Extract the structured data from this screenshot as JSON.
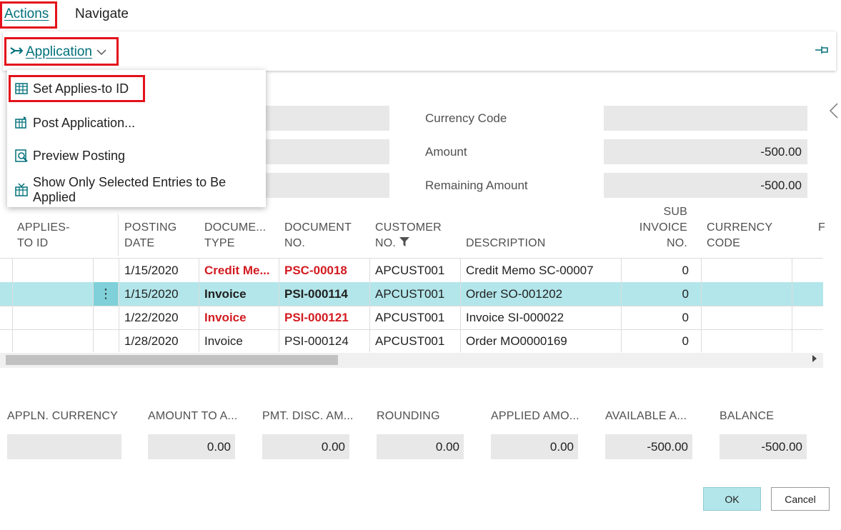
{
  "tabs": {
    "actions": "Actions",
    "navigate": "Navigate"
  },
  "action_bar": {
    "application_label": "Application",
    "app_icon": "application-arrow-icon",
    "pin_icon": "pin-icon"
  },
  "menu": {
    "items": [
      {
        "label": "Set Applies-to ID",
        "icon": "set-applies-to-icon"
      },
      {
        "label": "Post Application...",
        "icon": "post-application-icon"
      },
      {
        "label": "Preview Posting",
        "icon": "preview-posting-icon"
      },
      {
        "label": "Show Only Selected Entries to Be Applied",
        "icon": "show-selected-icon"
      }
    ]
  },
  "header_fields": {
    "currency_code": {
      "label": "Currency Code",
      "value": ""
    },
    "amount": {
      "label": "Amount",
      "value": "-500.00"
    },
    "remaining_amount": {
      "label": "Remaining Amount",
      "value": "-500.00"
    }
  },
  "table": {
    "columns": {
      "applies_to_id": [
        "APPLIES-",
        "TO ID"
      ],
      "posting_date": [
        "POSTING",
        "DATE"
      ],
      "document_type": [
        "DOCUME...",
        "TYPE"
      ],
      "document_no": [
        "DOCUMENT",
        "NO."
      ],
      "customer_no": [
        "CUSTOMER",
        "NO."
      ],
      "description": [
        "DESCRIPTION"
      ],
      "sub_invoice_no": [
        "SUB",
        "INVOICE",
        "NO."
      ],
      "currency_code": [
        "CURRENCY",
        "CODE"
      ],
      "truncated": "F"
    },
    "rows": [
      {
        "posting_date": "1/15/2020",
        "document_type": "Credit Me...",
        "document_no": "PSC-00018",
        "customer_no": "APCUST001",
        "description": "Credit Memo SC-00007",
        "sub_invoice_no": "0"
      },
      {
        "posting_date": "1/15/2020",
        "document_type": "Invoice",
        "document_no": "PSI-000114",
        "customer_no": "APCUST001",
        "description": "Order SO-001202",
        "sub_invoice_no": "0"
      },
      {
        "posting_date": "1/22/2020",
        "document_type": "Invoice",
        "document_no": "PSI-000121",
        "customer_no": "APCUST001",
        "description": "Invoice SI-000022",
        "sub_invoice_no": "0"
      },
      {
        "posting_date": "1/28/2020",
        "document_type": "Invoice",
        "document_no": "PSI-000124",
        "customer_no": "APCUST001",
        "description": "Order MO0000169",
        "sub_invoice_no": "0"
      }
    ],
    "row_menu": "⋮"
  },
  "footer": {
    "appln_currency": {
      "label": "APPLN. CURRENCY",
      "value": ""
    },
    "amount_to_apply": {
      "label": "AMOUNT TO A...",
      "value": "0.00"
    },
    "pmt_disc_amount": {
      "label": "PMT. DISC. AM...",
      "value": "0.00"
    },
    "rounding": {
      "label": "ROUNDING",
      "value": "0.00"
    },
    "applied_amount": {
      "label": "APPLIED AMO...",
      "value": "0.00"
    },
    "available_amount": {
      "label": "AVAILABLE A...",
      "value": "-500.00"
    },
    "balance": {
      "label": "BALANCE",
      "value": "-500.00"
    }
  },
  "buttons": {
    "ok": "OK",
    "cancel": "Cancel"
  },
  "colors": {
    "accent": "#00707a",
    "highlight": "#e3121b",
    "selected_row": "#b3e6ea",
    "negative_text": "#d21b21"
  }
}
